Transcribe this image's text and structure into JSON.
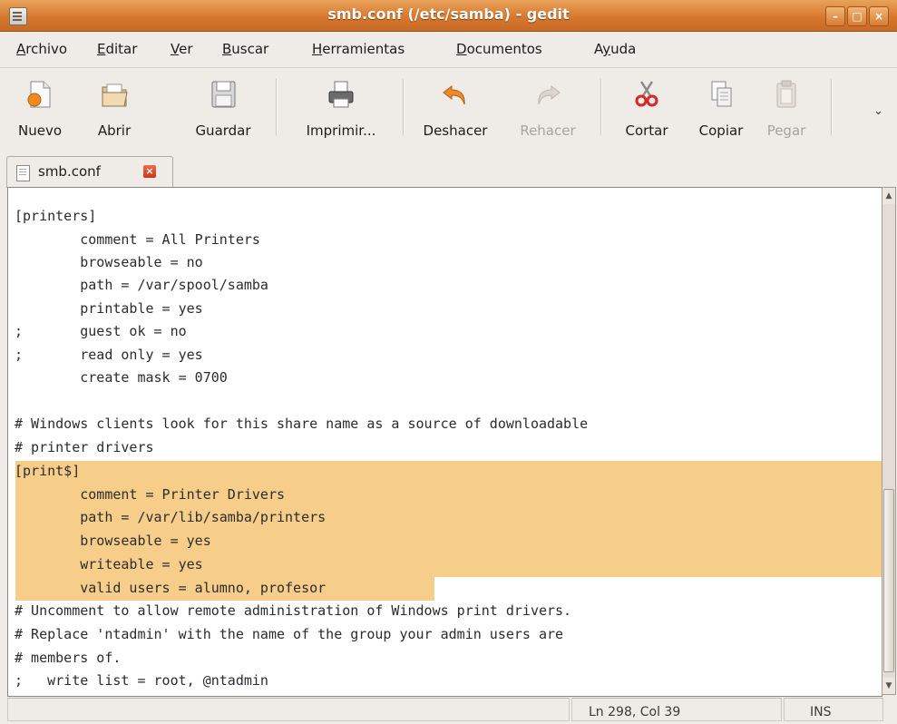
{
  "window": {
    "title": "smb.conf (/etc/samba) - gedit",
    "controls": {
      "minimize": "–",
      "maximize": "□",
      "close": "×"
    }
  },
  "menu": [
    {
      "pre": "",
      "mn": "A",
      "post": "rchivo"
    },
    {
      "pre": "",
      "mn": "E",
      "post": "ditar"
    },
    {
      "pre": "",
      "mn": "V",
      "post": "er"
    },
    {
      "pre": "",
      "mn": "B",
      "post": "uscar"
    },
    {
      "pre": "",
      "mn": "H",
      "post": "erramientas"
    },
    {
      "pre": "",
      "mn": "D",
      "post": "ocumentos"
    },
    {
      "pre": "A",
      "mn": "y",
      "post": "uda"
    }
  ],
  "toolbar": {
    "new": "Nuevo",
    "open": "Abrir",
    "save": "Guardar",
    "print": "Imprimir...",
    "undo": "Deshacer",
    "redo": "Rehacer",
    "cut": "Cortar",
    "copy": "Copiar",
    "paste": "Pegar",
    "overflow": "⌄"
  },
  "tab": {
    "label": "smb.conf",
    "close": "×"
  },
  "editor": {
    "lines": [
      "[printers]",
      "        comment = All Printers",
      "        browseable = no",
      "        path = /var/spool/samba",
      "        printable = yes",
      ";       guest ok = no",
      ";       read only = yes",
      "        create mask = 0700",
      "",
      "# Windows clients look for this share name as a source of downloadable",
      "# printer drivers",
      "[print$]",
      "        comment = Printer Drivers",
      "        path = /var/lib/samba/printers",
      "        browseable = yes",
      "        writeable = yes",
      "        valid users = alumno, profesor",
      "# Uncomment to allow remote administration of Windows print drivers.",
      "# Replace 'ntadmin' with the name of the group your admin users are",
      "# members of.",
      ";   write list = root, @ntadmin"
    ]
  },
  "status": {
    "position": "Ln 298, Col 39",
    "mode": "INS"
  },
  "colors": {
    "titlebar": "#d7782f",
    "selection": "#f7cd8a",
    "background": "#efebe7"
  }
}
